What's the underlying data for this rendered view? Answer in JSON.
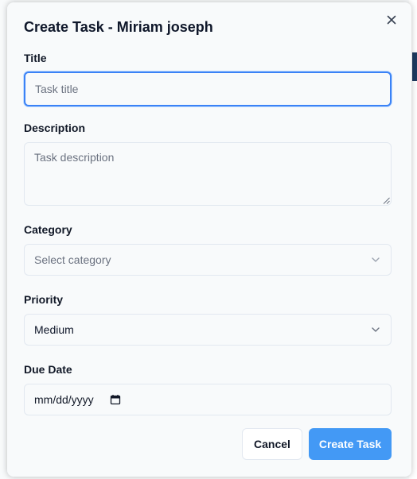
{
  "modal": {
    "title": "Create Task - Miriam joseph",
    "close_icon": "close-icon"
  },
  "fields": {
    "title": {
      "label": "Title",
      "placeholder": "Task title",
      "value": ""
    },
    "description": {
      "label": "Description",
      "placeholder": "Task description",
      "value": ""
    },
    "category": {
      "label": "Category",
      "placeholder": "Select category",
      "icon": "chevron-down-icon"
    },
    "priority": {
      "label": "Priority",
      "selected": "Medium",
      "icon": "chevron-down-icon"
    },
    "due_date": {
      "label": "Due Date",
      "value": "mm/dd/yyyy",
      "icon": "calendar-icon"
    }
  },
  "actions": {
    "cancel_label": "Cancel",
    "create_label": "Create Task"
  },
  "colors": {
    "accent": "#4399f5",
    "focus_ring": "#3b82f6",
    "backdrop_border": "#c62828"
  }
}
